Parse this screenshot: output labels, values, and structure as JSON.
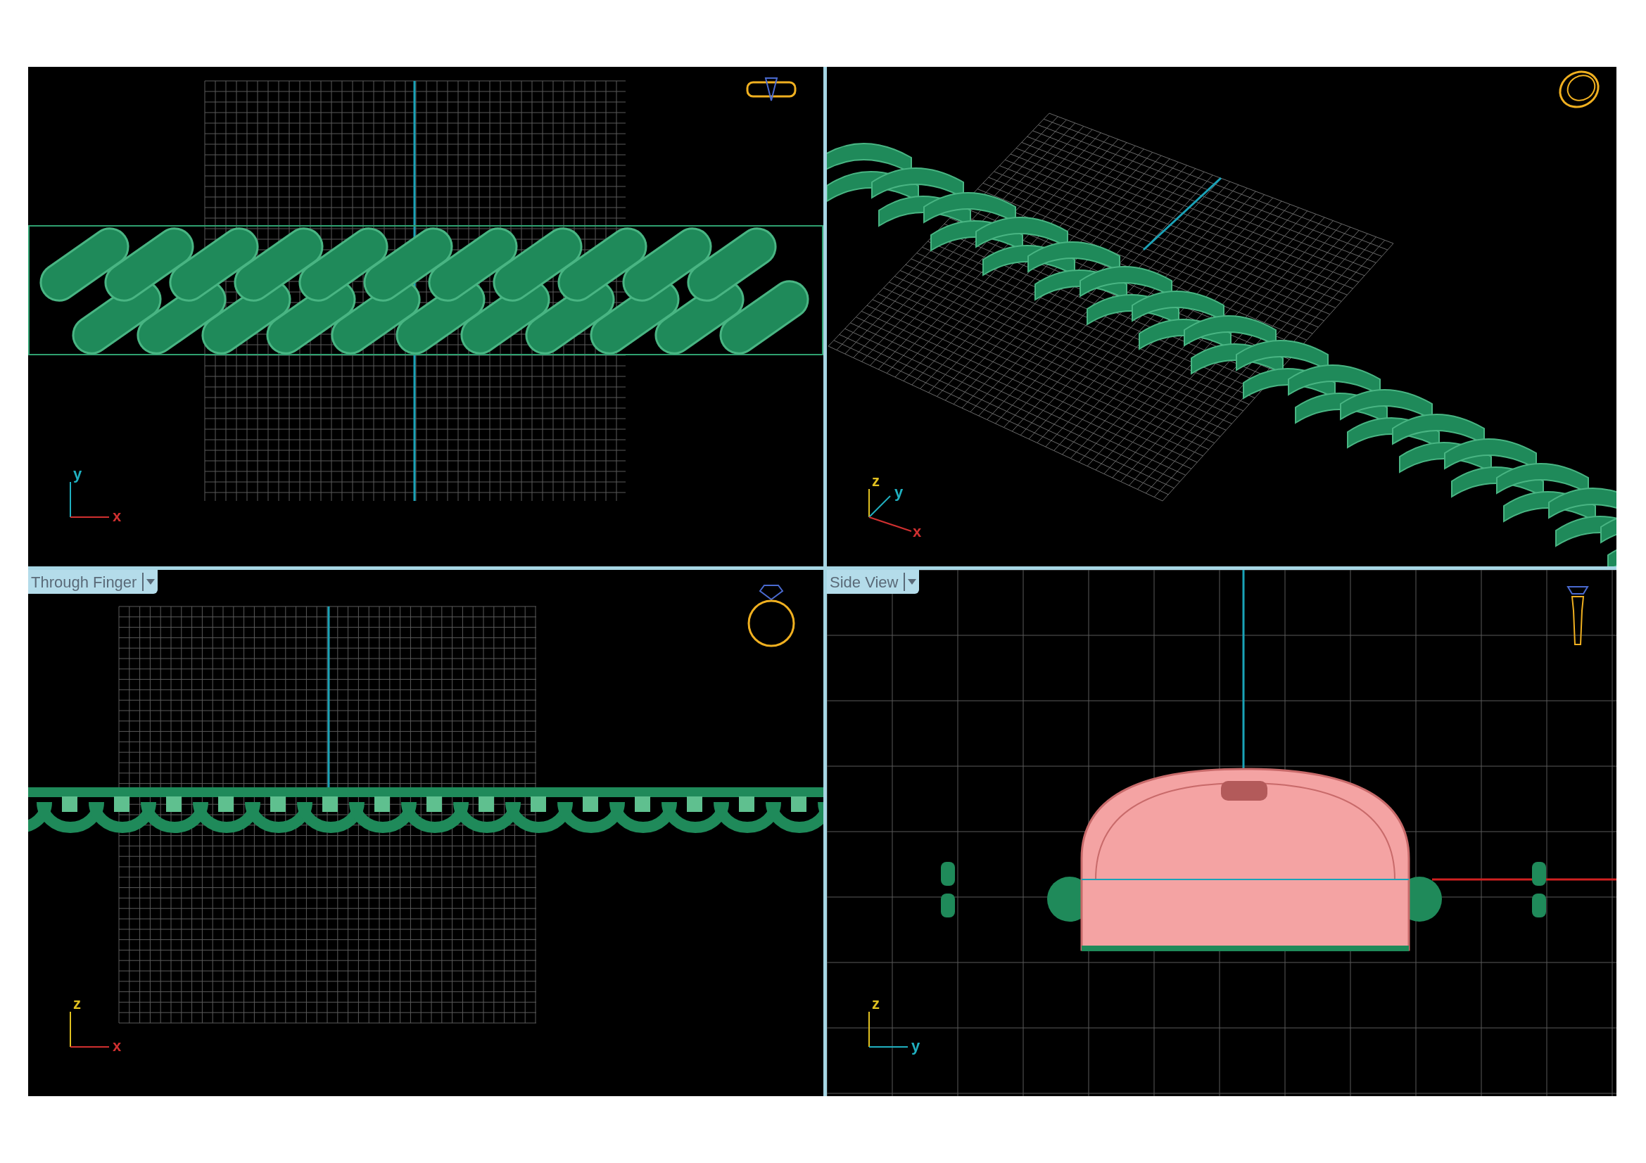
{
  "viewports": [
    {
      "kind": "top",
      "axes": [
        "y",
        "x"
      ]
    },
    {
      "kind": "perspective",
      "axes": [
        "z",
        "y",
        "x"
      ]
    },
    {
      "kind": "front",
      "label": "Through Finger",
      "axes": [
        "z",
        "x"
      ]
    },
    {
      "kind": "side",
      "label": "Side View",
      "axes": [
        "z",
        "y"
      ]
    }
  ]
}
